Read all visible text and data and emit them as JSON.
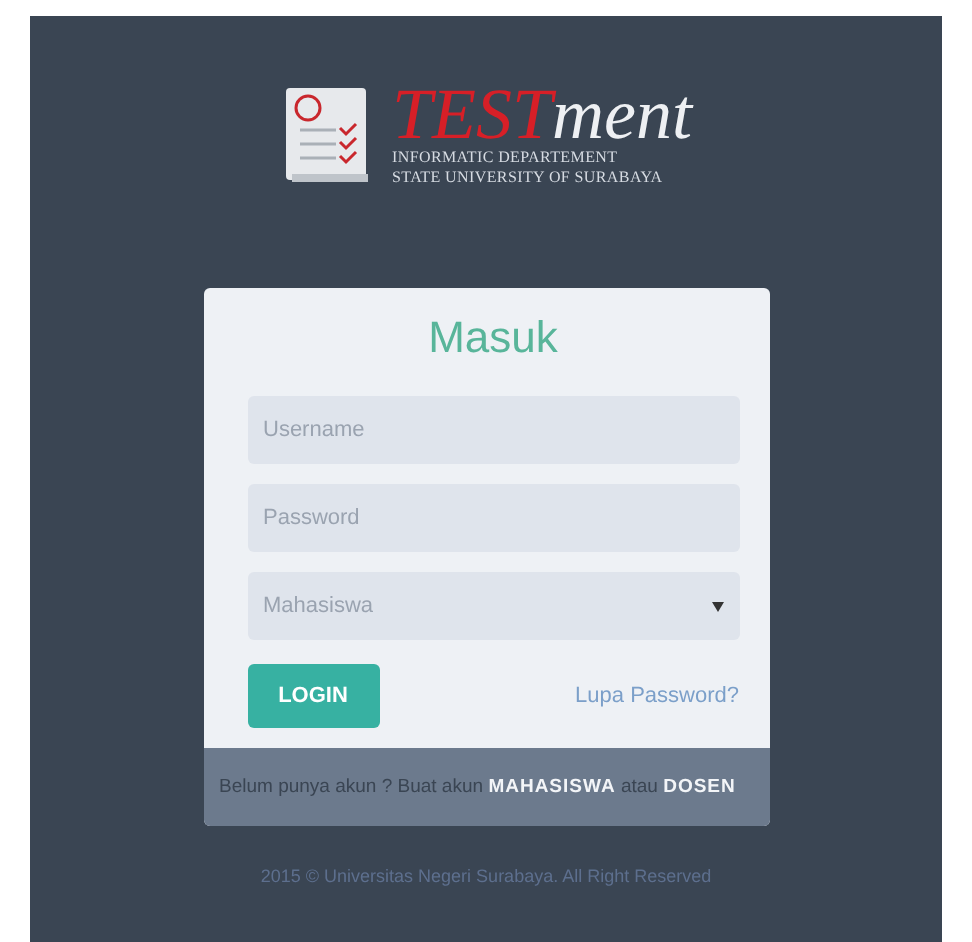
{
  "logo": {
    "title_red": "TEST",
    "title_rest": "ment",
    "line_1": "INFORMATIC DEPARTEMENT",
    "line_2": "STATE UNIVERSITY OF SURABAYA"
  },
  "login_card": {
    "title": "Masuk",
    "fields": [
      {
        "kind": "text",
        "placeholder": "Username"
      },
      {
        "kind": "password",
        "placeholder": "Password"
      },
      {
        "kind": "select",
        "value": "Mahasiswa"
      }
    ],
    "login_button": "LOGIN",
    "forgot_link": "Lupa Password?",
    "register": {
      "prefix": "Belum punya akun ? Buat akun",
      "link_1": "MAHASISWA",
      "middle": "atau",
      "link_2": "DOSEN"
    }
  },
  "footer": "2015 © Universitas Negeri Surabaya. All Right Reserved"
}
